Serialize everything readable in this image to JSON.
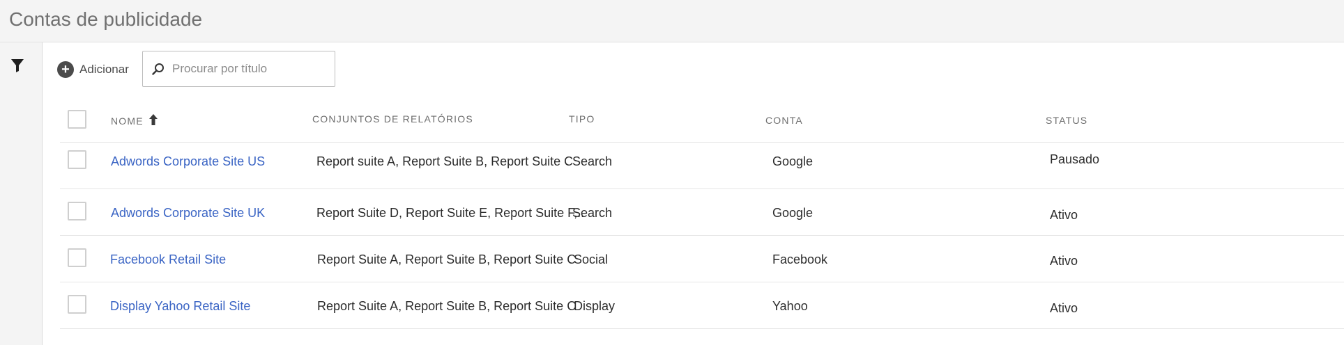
{
  "header": {
    "title": "Contas de publicidade"
  },
  "toolbar": {
    "add_label": "Adicionar",
    "search_placeholder": "Procurar por título"
  },
  "table": {
    "columns": {
      "name": "NOME",
      "report_suites": "CONJUNTOS DE RELATÓRIOS",
      "type": "TIPO",
      "account": "CONTA",
      "status": "STATUS"
    },
    "sort": {
      "column": "NOME",
      "direction": "ascending"
    },
    "rows": [
      {
        "name": "Adwords Corporate Site US",
        "report_suites": "Report suite A, Report Suite B, Report Suite C",
        "type": "Search",
        "account": "Google",
        "status": "Pausado"
      },
      {
        "name": "Adwords Corporate Site UK",
        "report_suites": "Report Suite D, Report Suite E, Report Suite F,..",
        "type": "Search",
        "account": "Google",
        "status": "Ativo"
      },
      {
        "name": "Facebook Retail Site",
        "report_suites": "Report Suite A, Report Suite B, Report Suite C",
        "type": "Social",
        "account": "Facebook",
        "status": "Ativo"
      },
      {
        "name": "Display Yahoo Retail Site",
        "report_suites": "Report Suite A, Report Suite B, Report Suite C",
        "type": "Display",
        "account": "Yahoo",
        "status": "Ativo"
      }
    ]
  },
  "colors": {
    "link": "#3a64c4",
    "header_bg": "#f4f4f4"
  },
  "icons": {
    "filter": "filter-icon",
    "add": "add-circle-icon",
    "search": "search-icon",
    "sort": "sort-ascending-icon"
  }
}
